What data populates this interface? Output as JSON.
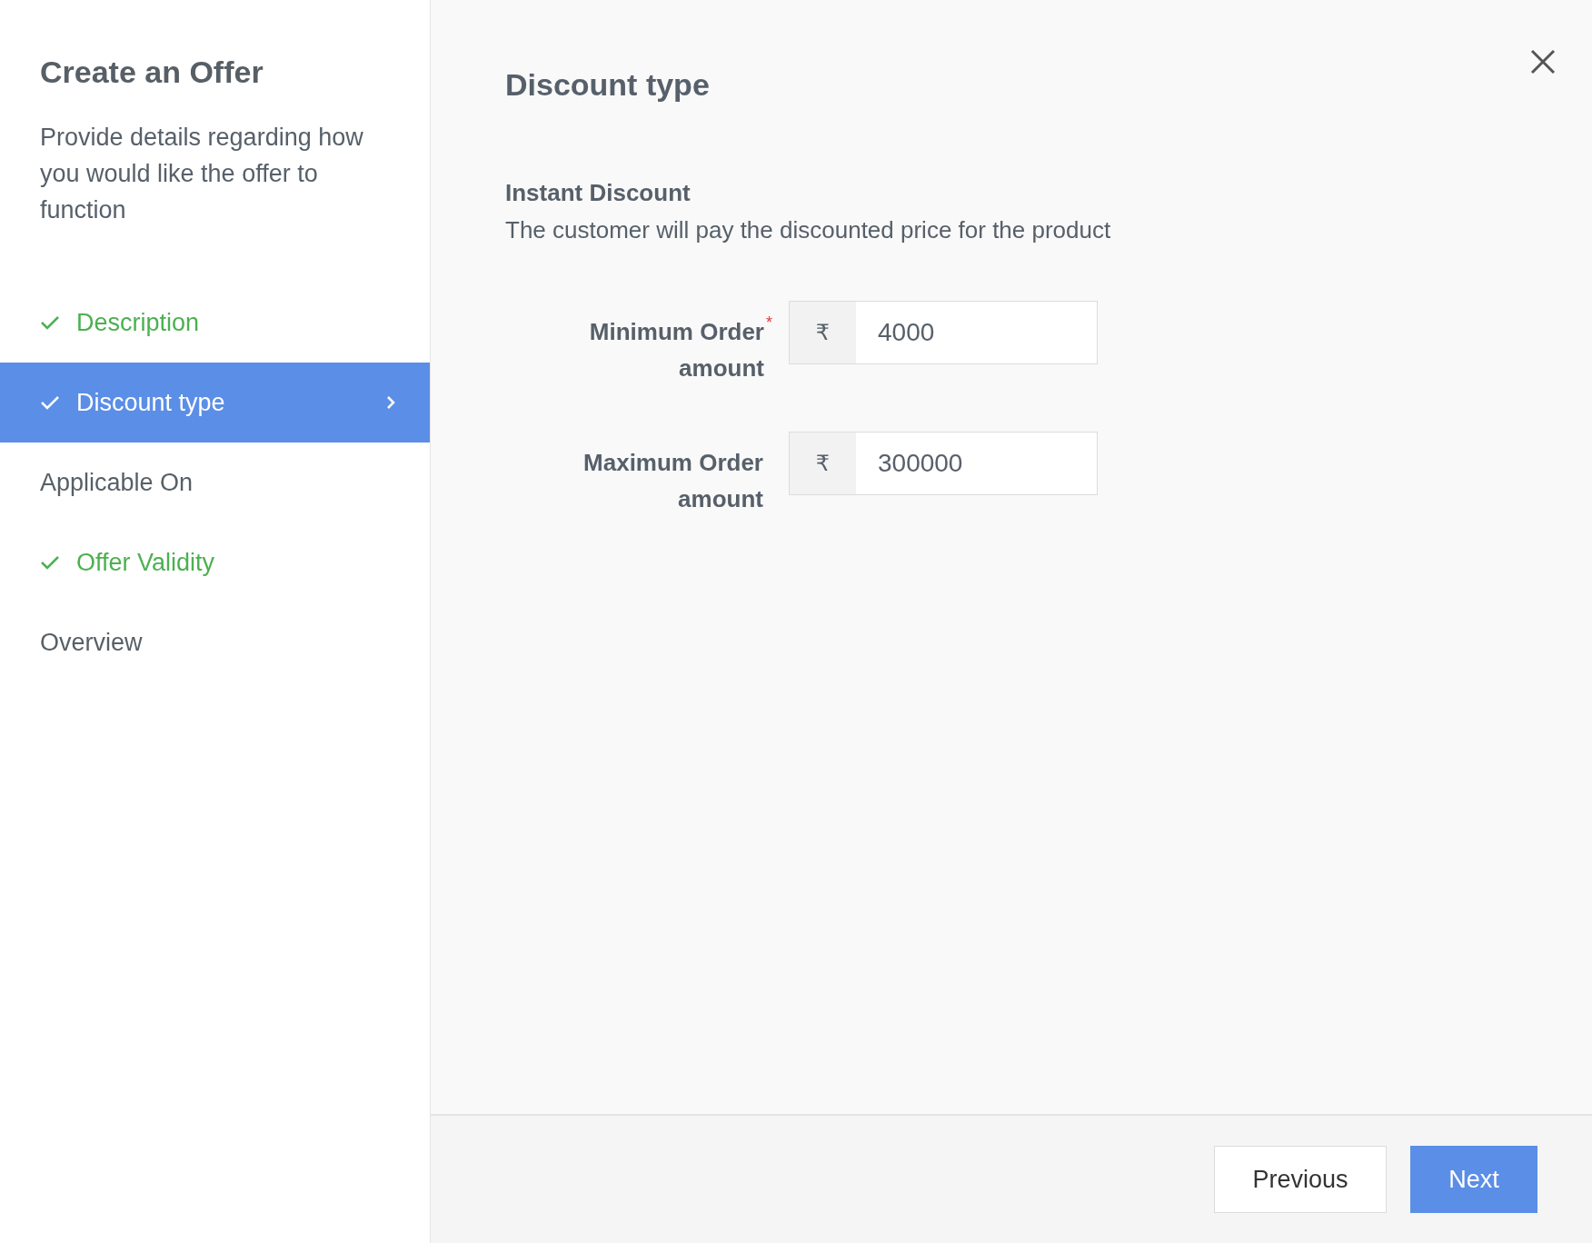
{
  "sidebar": {
    "title": "Create an Offer",
    "description": "Provide details regarding how you would like the offer to function",
    "steps": [
      {
        "label": "Description",
        "completed": true,
        "selected": false
      },
      {
        "label": "Discount type",
        "completed": true,
        "selected": true
      },
      {
        "label": "Applicable On",
        "completed": false,
        "selected": false
      },
      {
        "label": "Offer Validity",
        "completed": true,
        "selected": false
      },
      {
        "label": "Overview",
        "completed": false,
        "selected": false
      }
    ]
  },
  "main": {
    "title": "Discount type",
    "section_title": "Instant Discount",
    "section_description": "The customer will pay the discounted price for the product",
    "fields": [
      {
        "label": "Minimum Order amount",
        "required_mark": "*",
        "prefix": "₹",
        "value": "4000"
      },
      {
        "label": "Maximum Order amount",
        "prefix": "₹",
        "value": "300000"
      }
    ]
  },
  "footer": {
    "buttons": [
      {
        "label": "Previous",
        "kind": "secondary"
      },
      {
        "label": "Next",
        "kind": "primary"
      }
    ]
  }
}
